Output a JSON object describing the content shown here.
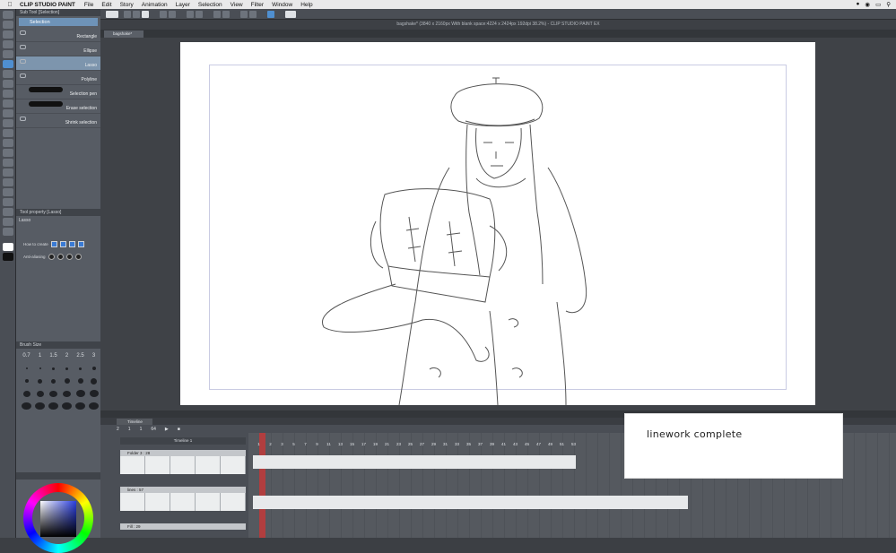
{
  "menubar": {
    "app_name": "CLIP STUDIO PAINT",
    "items": [
      "File",
      "Edit",
      "Story",
      "Animation",
      "Layer",
      "Selection",
      "View",
      "Filter",
      "Window",
      "Help"
    ]
  },
  "document": {
    "title": "bagshake* (3840 x 2160px With blank space:4224 x 2424px 192dpi 38.2%)  - CLIP STUDIO PAINT EX",
    "tab_label": "bagshake*"
  },
  "subtool": {
    "panel_title": "Sub Tool [Selection]",
    "group_tab": "Selection",
    "items": [
      {
        "label": "Rectangle",
        "selected": false
      },
      {
        "label": "Ellipse",
        "selected": false
      },
      {
        "label": "Lasso",
        "selected": true
      },
      {
        "label": "Polyline",
        "selected": false
      },
      {
        "label": "Selection pen",
        "selected": false
      },
      {
        "label": "Erase selection",
        "selected": false
      },
      {
        "label": "Shrink selection",
        "selected": false
      }
    ]
  },
  "tool_property": {
    "panel_title": "Tool property [Lasso]",
    "tool_name": "Lasso",
    "how_to_create_label": "How to create",
    "anti_aliasing_label": "Anti-aliasing"
  },
  "brush_size": {
    "panel_title": "Brush Size",
    "sizes": [
      "0.7",
      "1",
      "1.5",
      "2",
      "2.5",
      "3"
    ]
  },
  "timeline": {
    "tab_label": "Timeline",
    "name": "Timeline 1",
    "fps_fields": [
      "2",
      "1",
      "1",
      "64"
    ],
    "tracks": [
      {
        "label": "Folder 3 : 28",
        "cells": [
          "1",
          "4",
          "5",
          "6",
          "7"
        ]
      },
      {
        "label": "lines : 57",
        "cells": [
          "42",
          "92 Copy",
          "92 Copy 2",
          "92 Copy",
          "1a"
        ]
      },
      {
        "label": "Fill : 29",
        "cells": []
      }
    ],
    "frame_numbers": [
      "1",
      "2",
      "3",
      "5",
      "7",
      "9",
      "11",
      "13",
      "15",
      "17",
      "19",
      "21",
      "23",
      "25",
      "27",
      "29",
      "31",
      "33",
      "35",
      "37",
      "39",
      "41",
      "43",
      "45",
      "47",
      "49",
      "51",
      "53"
    ],
    "track2_numbers": [
      "3",
      "4",
      "5",
      "6",
      "7",
      "8",
      "9",
      "10",
      "11",
      "12",
      "13",
      "14",
      "15",
      "16",
      "17",
      "18",
      "19",
      "20",
      "21",
      "22",
      "23",
      "24",
      "25",
      "26",
      "27",
      "28"
    ]
  },
  "note": {
    "text": "linework complete"
  }
}
